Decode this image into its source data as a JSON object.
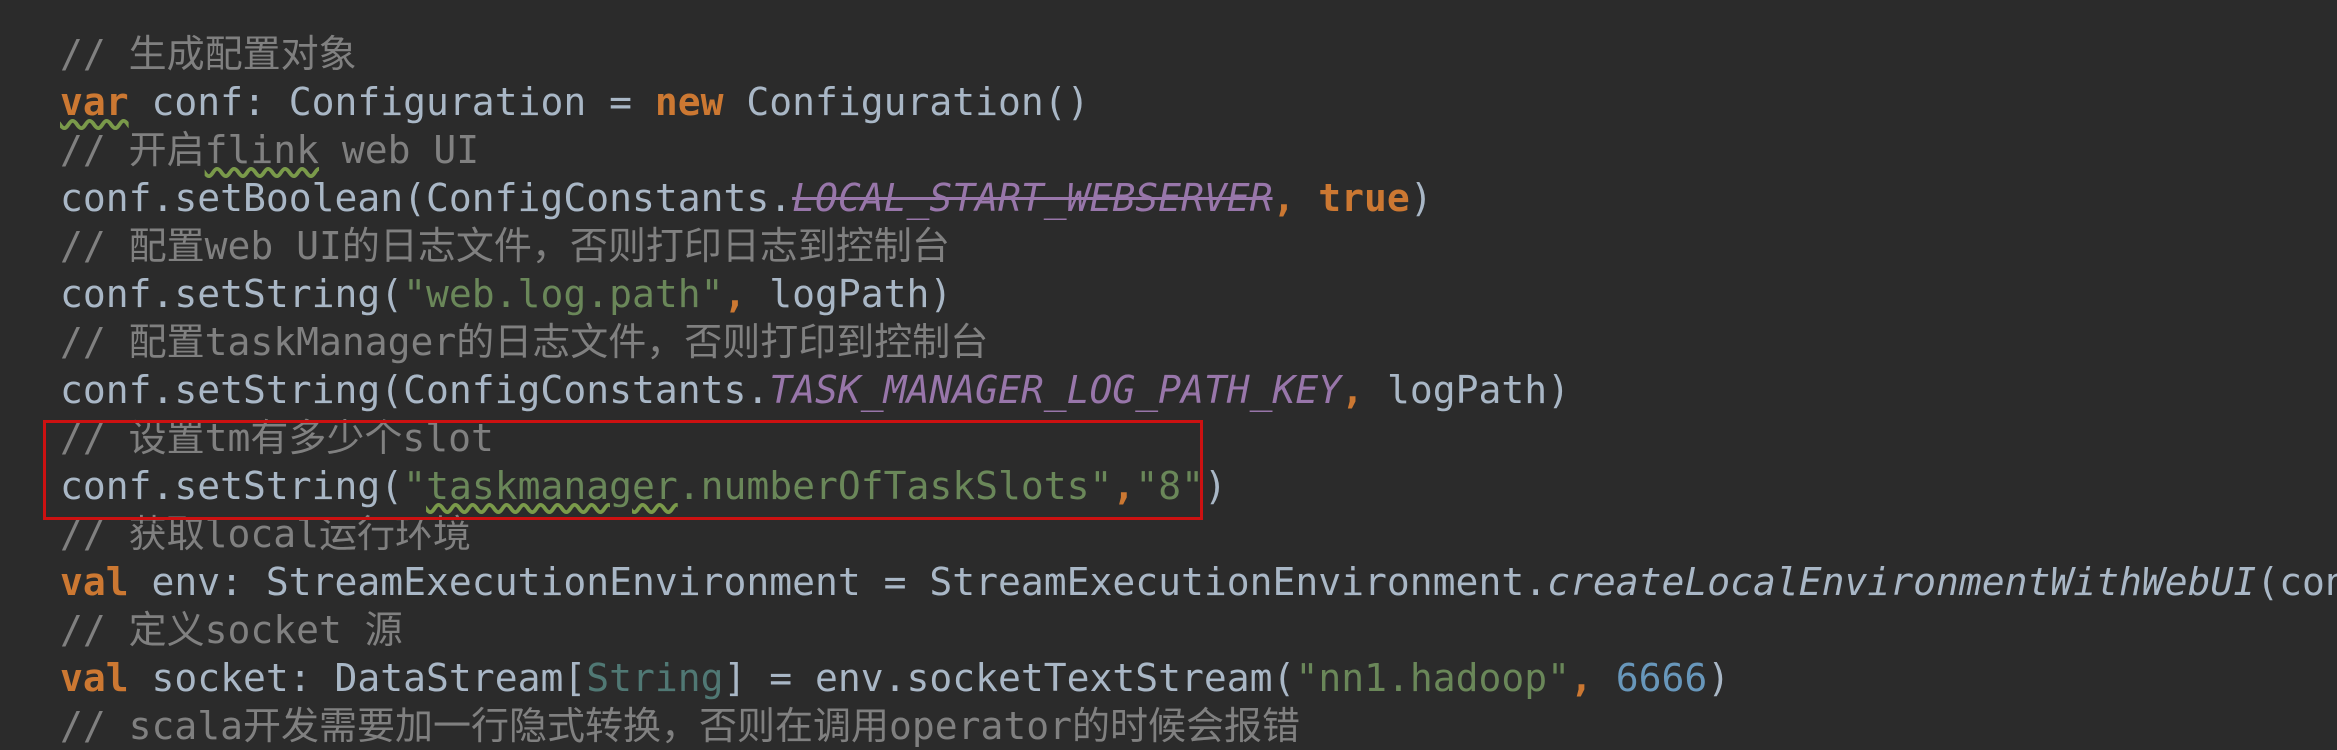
{
  "code": {
    "l1": "// 生成配置对象",
    "l2": {
      "kw1": "var",
      "a": " conf: Configuration = ",
      "kw2": "new",
      "b": " Configuration()"
    },
    "l3": {
      "a": "// 开启",
      "b": "flink",
      "c": " web UI"
    },
    "l4": {
      "a": "conf.setBoolean(ConfigConstants.",
      "const": "LOCAL_START_WEBSERVER",
      "sep": ", ",
      "kw": "true",
      "end": ")"
    },
    "l5": "// 配置web UI的日志文件，否则打印日志到控制台",
    "l6": {
      "a": "conf.setString(",
      "str": "\"web.log.path\"",
      "sep": ", ",
      "b": "logPath)"
    },
    "l7": "// 配置taskManager的日志文件，否则打印到控制台",
    "l8": {
      "a": "conf.setString(ConfigConstants.",
      "const": "TASK_MANAGER_LOG_PATH_KEY",
      "sep": ", ",
      "b": "logPath)"
    },
    "l9": "// 设置tm有多少个slot",
    "l10": {
      "a": "conf.setString(",
      "q": "\"",
      "sq": "taskmanager",
      "str": ".numberOfTaskSlots\"",
      "sep": ",",
      "str2": "\"8\"",
      "end": ")"
    },
    "l11": "// 获取local运行环境",
    "l12": {
      "kw": "val",
      "a": " env: StreamExecutionEnvironment = StreamExecutionEnvironment.",
      "it": "createLocalEnvironmentWithWebUI",
      "end": "(conf)"
    },
    "l13": "// 定义socket 源",
    "l14": {
      "kw": "val",
      "a": " socket: DataStream[",
      "typ": "String",
      "b": "] = env.socketTextStream(",
      "str": "\"nn1.hadoop\"",
      "sep": ", ",
      "num": "6666",
      "end": ")"
    },
    "l15": "// scala开发需要加一行隐式转换，否则在调用operator的时候会报错"
  },
  "colors": {
    "background": "#2b2b2b",
    "comment": "#808080",
    "keyword": "#cc7832",
    "string": "#6a8759",
    "constant": "#9876aa",
    "number": "#6897bb",
    "highlight_box": "#cc1111"
  }
}
